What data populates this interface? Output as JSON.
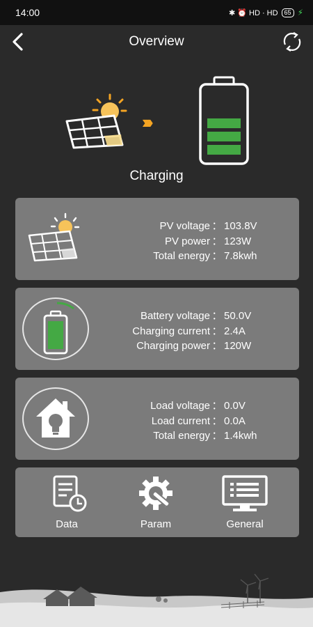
{
  "status_bar": {
    "time": "14:00",
    "indicators": "✱ ⏰ HD · HD",
    "battery_level": "65"
  },
  "header": {
    "title": "Overview",
    "back_icon": "chevron-left-icon",
    "refresh_icon": "refresh-icon"
  },
  "hero": {
    "arrows": "››››",
    "status_label": "Charging"
  },
  "pv": {
    "rows": [
      {
        "label": "PV voltage",
        "sep": "：",
        "value": "103.8V"
      },
      {
        "label": "PV power",
        "sep": "：",
        "value": "123W"
      },
      {
        "label": "Total energy",
        "sep": "：",
        "value": "7.8kwh"
      }
    ]
  },
  "battery": {
    "rows": [
      {
        "label": "Battery voltage",
        "sep": "：",
        "value": "50.0V"
      },
      {
        "label": "Charging current",
        "sep": "：",
        "value": "2.4A"
      },
      {
        "label": "Charging power",
        "sep": "：",
        "value": "120W"
      }
    ]
  },
  "load": {
    "rows": [
      {
        "label": "Load voltage",
        "sep": "：",
        "value": "0.0V"
      },
      {
        "label": "Load current",
        "sep": "：",
        "value": "0.0A"
      },
      {
        "label": "Total energy",
        "sep": "：",
        "value": "1.4kwh"
      }
    ]
  },
  "nav": {
    "data_label": "Data",
    "param_label": "Param",
    "general_label": "General"
  },
  "colors": {
    "background": "#2a2a2a",
    "card": "#7b7b7b",
    "battery_green": "#44a944",
    "accent_orange": "#f4a423"
  }
}
